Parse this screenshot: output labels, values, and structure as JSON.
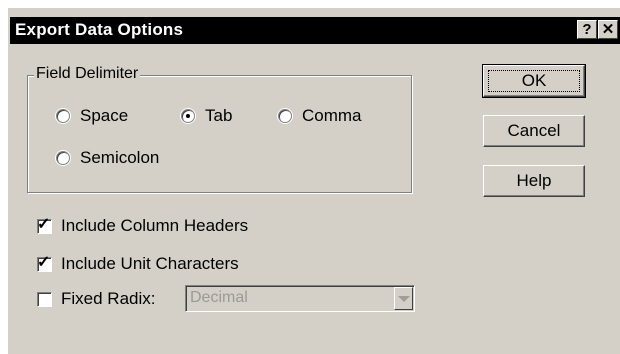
{
  "window": {
    "title": "Export Data Options",
    "help_label": "?",
    "close_label": "✕"
  },
  "field_delimiter": {
    "label": "Field Delimiter",
    "options": [
      {
        "label": "Space",
        "selected": false
      },
      {
        "label": "Tab",
        "selected": true
      },
      {
        "label": "Comma",
        "selected": false
      },
      {
        "label": "Semicolon",
        "selected": false
      }
    ]
  },
  "checkboxes": [
    {
      "label": "Include Column Headers",
      "checked": true
    },
    {
      "label": "Include Unit Characters",
      "checked": true
    },
    {
      "label": "Fixed Radix:",
      "checked": false
    }
  ],
  "radix_select": {
    "value": "Decimal",
    "enabled": false
  },
  "buttons": {
    "ok": "OK",
    "cancel": "Cancel",
    "help": "Help"
  },
  "colors": {
    "dialog_bg": "#d4d0c8",
    "titlebar_bg": "#000000",
    "disabled_text": "#9c9a94"
  }
}
